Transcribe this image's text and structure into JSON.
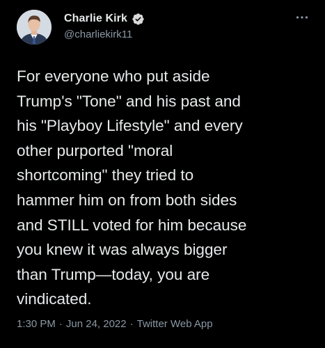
{
  "author": {
    "display_name": "Charlie Kirk",
    "handle": "@charliekirk11",
    "verified": true
  },
  "icons": {
    "avatar": "profile-photo",
    "verified": "verified-badge-icon",
    "more": "more-options-icon"
  },
  "colors": {
    "background": "#000000",
    "text": "#e7e9ea",
    "secondary_text": "#8b98a5",
    "verified_badge": "#d9d9d9"
  },
  "tweet": {
    "text": "For everyone who put aside\nTrump's \"Tone\" and his past and\nhis \"Playboy Lifestyle\" and every\nother purported \"moral\nshortcoming\" they tried to\nhammer him on from both sides\nand STILL voted for him because\nyou knew it was always bigger\nthan Trump—today, you are\nvindicated.",
    "time": "1:30 PM",
    "separator_1": "·",
    "date": "Jun 24, 2022",
    "separator_2": "·",
    "source": "Twitter Web App"
  }
}
